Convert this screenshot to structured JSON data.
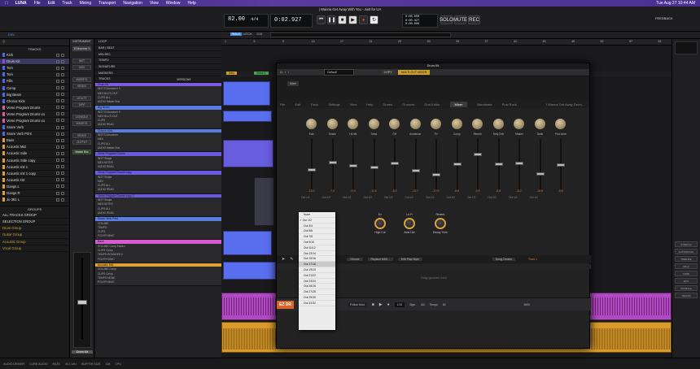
{
  "menubar": {
    "app": "LUNA",
    "items": [
      "File",
      "Edit",
      "Track",
      "Mixing",
      "Transport",
      "Navigation",
      "View",
      "Window",
      "Help"
    ],
    "title": "| Wanna Get Away With You - Just for UA",
    "clock": "Tue Aug 27  10:44 AM",
    "feedback": "FEEDBACK"
  },
  "transport": {
    "tempo": "82.00",
    "signature": "4/4",
    "time": "0:02.927",
    "bars": "0:00.000",
    "bars2": "0:00.327",
    "bars3": "0:00.000",
    "sample_rate": "44.1 kHz",
    "solo": "SOLO",
    "mute": "MUTE",
    "rec": "REC",
    "playhead_label": "INPUT"
  },
  "toolbar2": {
    "left": "ENV",
    "badge": "SOLO",
    "b2": "LATCH",
    "b3": "1/16"
  },
  "sidebar": {
    "header": "TRACKS",
    "tracks": [
      {
        "name": "Kick",
        "color": "#4a6be0"
      },
      {
        "name": "Drum Kit",
        "color": "#8a4ae0"
      },
      {
        "name": "Tom",
        "color": "#4a6be0"
      },
      {
        "name": "Tom",
        "color": "#4a6be0"
      },
      {
        "name": "Fills",
        "color": "#4a6be0"
      },
      {
        "name": "Comp",
        "color": "#4a6be0"
      },
      {
        "name": "Big Beam",
        "color": "#4a6be0"
      },
      {
        "name": "Chorus Kick",
        "color": "#4a6be0"
      },
      {
        "name": "Verse Program Drums",
        "color": "#d85aa0"
      },
      {
        "name": "Verse Program Drums co",
        "color": "#d85aa0"
      },
      {
        "name": "Verse Program Drums co",
        "color": "#d85aa0"
      },
      {
        "name": "Snare Verb",
        "color": "#4a6be0"
      },
      {
        "name": "Snare Verb Print",
        "color": "#4a6be0"
      },
      {
        "name": "Bass",
        "color": "#e0a030"
      },
      {
        "name": "Acoustic Mid",
        "color": "#e0a030"
      },
      {
        "name": "Acoustic Side",
        "color": "#e0a030"
      },
      {
        "name": "Acoustic Side copy",
        "color": "#e0a030"
      },
      {
        "name": "Acoustic mit 1",
        "color": "#e0a030"
      },
      {
        "name": "Acoustic mit 1 copy",
        "color": "#e0a030"
      },
      {
        "name": "Acoustic Gtr",
        "color": "#e0a030"
      },
      {
        "name": "Gangs L",
        "color": "#e0a030"
      },
      {
        "name": "Gangs R",
        "color": "#e0a030"
      },
      {
        "name": "Jo 381 L",
        "color": "#e0a030"
      }
    ],
    "groups_header": "GROUPS",
    "groups": [
      "ALL TRACKS GROUP",
      "SELECTION GROUP",
      "Drum Group",
      "Guitar Group",
      "Acoustic Group",
      "Vocal Group"
    ]
  },
  "instrument": {
    "header": "INSTRUMENT",
    "plugin": "EZdrummer 3",
    "buttons": [
      "INST",
      "MIDI",
      "INSERTS",
      "SENDS",
      "UTILITY",
      "TAPE",
      "CONSOLE",
      "INSERTS",
      "SENDS",
      "OUTPUT"
    ],
    "output": "Master Bus",
    "track_name": "Drum Kit"
  },
  "trackhead": {
    "rows": [
      "LOOP",
      "BAR | BEAT",
      "MIN:SEC",
      "TEMPO",
      "SIGNATURE",
      "MARKERS",
      "TRACKS"
    ],
    "versions": "VERSIONS",
    "tracks": [
      {
        "name": "Drum Kit",
        "color": "#7b5ce0",
        "lines": [
          "INST  EZdrummer 3",
          "MIDI  MULTI-OUT",
          "CLIPS  ALL",
          "AUDIO  Master Bus"
        ]
      },
      {
        "name": "Big Beam",
        "color": "#5a7de0",
        "lines": [
          "INST  EZdrummer 3",
          "MIDI  MULTI-OUT",
          "CLIPS",
          "AUDIO  READ"
        ]
      },
      {
        "name": "Chorus Kick",
        "color": "#5a7de0",
        "lines": [
          "INST  EZdrummer",
          "MIDI",
          "CLIPS  ALL",
          "AUDIO  Master Bus"
        ]
      },
      {
        "name": "Verse Program Drums",
        "color": "#6a5ae0",
        "lines": [
          "INST  Shape",
          "MIDI  NOTES",
          "AUDIO  READ"
        ]
      },
      {
        "name": "Verse Program Drums copy",
        "color": "#6a5ae0",
        "lines": [
          "INST  Shape",
          "MIDI",
          "CLIPS  ALL",
          "AUDIO  READ"
        ]
      },
      {
        "name": "Verse Program Drums copy 2",
        "color": "#6a5ae0",
        "lines": [
          "INST  Shape",
          "MIDI  NOTES",
          "CLIPS  ALL",
          "AUDIO  READ"
        ]
      },
      {
        "name": "Snare Verb Print",
        "color": "#5a7de0",
        "lines": [
          "VOLUME",
          "TEMPO",
          "CLIPS",
          "POLYPHONIC"
        ]
      },
      {
        "name": "Bass",
        "color": "#d85ad0",
        "lines": [
          "VOLUME  Comp Fasten",
          "CLIPS  Comp",
          "TEMPO  BOUNDED 2",
          "POLYPHONIC"
        ]
      },
      {
        "name": "Acoustic Mid",
        "color": "#e0a030",
        "lines": [
          "VOLUME  Comp",
          "CLIPS  Comp",
          "TEMPO  NONE",
          "POLYPHONIC"
        ]
      }
    ]
  },
  "ruler": {
    "marks": [
      "1",
      "5",
      "9",
      "13",
      "17",
      "21",
      "25",
      "29",
      "33",
      "37",
      "41",
      "45",
      "49",
      "53",
      "57",
      "61"
    ],
    "markers": [
      "Intro",
      "Verse 1"
    ]
  },
  "ezdrummer": {
    "title": "Drum Kit",
    "preset": "Default",
    "copy": "COPY",
    "multi_out": "MULTI-OUT MIXER",
    "menus": [
      "File",
      "Edit",
      "Track",
      "Settings",
      "View",
      "Help"
    ],
    "tabs": [
      "Drums",
      "Grooves",
      "Grid Editor",
      "Mixer",
      "Bandmate",
      "Post Rock"
    ],
    "active_tab": "Mixer",
    "song": "I Wanna Get Away Drum...",
    "mixer_btn": "Mixer",
    "kit": [
      "Kick",
      "Snare",
      "Hi-Hat",
      "Toms",
      "OH",
      "Ambience",
      "FX",
      "Comp",
      "Reverb",
      "Dirty Drill",
      "Shaker",
      "Tamb",
      "Perc Amb"
    ],
    "fader_values": [
      "-13.0",
      "-7.2",
      "-9.9",
      "-11.6",
      "-8.2",
      "-13.7",
      "-17.0",
      "-8.6",
      "-0.9",
      "-8.5",
      "-8.2",
      "-16.5",
      "-9.5"
    ],
    "outs": [
      "Out 1/2",
      "Out 1/2",
      "Out 1/2",
      "Out 1/2",
      "Out 1/2",
      "Out 1/2",
      "Out 1/2",
      "Out 1/2",
      "Out 1/2",
      "Out 1/2",
      "Out 1/2",
      "Out 1/2"
    ],
    "knobs": [
      {
        "label": "Ex",
        "name": "High Cut"
      },
      {
        "label": "Lo Fi",
        "name": "Amb Dirt"
      },
      {
        "label": "Reverb",
        "name": "Decay Time"
      }
    ],
    "dropdown": [
      "None",
      "Out 1/2",
      "Out 3/4",
      "Out 5/6",
      "Out 7/8",
      "Out 9/10",
      "Out 11/12",
      "Out 13/14",
      "Out 15/16",
      "Out 17/18",
      "Out 19/20",
      "Out 21/22",
      "Out 23/24",
      "Out 25/26",
      "Out 27/28",
      "Out 29/30",
      "Out 31/32"
    ],
    "dropdown_checked": "Out 1/2",
    "dropdown_hover": "Out 17/18",
    "track_btns": [
      "Groove",
      "Replace MIDI...",
      "Edit Play Style"
    ],
    "song_creator": "Song Creator",
    "track_label": "Track 1",
    "drag_hint": "Drag grooves here",
    "logo": "EZ DR",
    "follow": "Follow Host",
    "sign": "Sign.",
    "sign_val": "4/4",
    "tempo_label": "Tempo",
    "tempo_val": "82",
    "bar_val": "1/16",
    "midi": "MIDI"
  },
  "rightpanel": {
    "btns": [
      "STRETCH",
      "AUTOMATION",
      "TIMELINE",
      "SOLO",
      "COMP",
      "EDIT",
      "CONSOLE",
      "TRACKS"
    ]
  },
  "statusbar": {
    "items": [
      "AUDIO DRIVER",
      "CORE AUDIO",
      "RATE",
      "44.1 kHz",
      "BUFFER SIZE",
      "128",
      "CPU"
    ]
  }
}
